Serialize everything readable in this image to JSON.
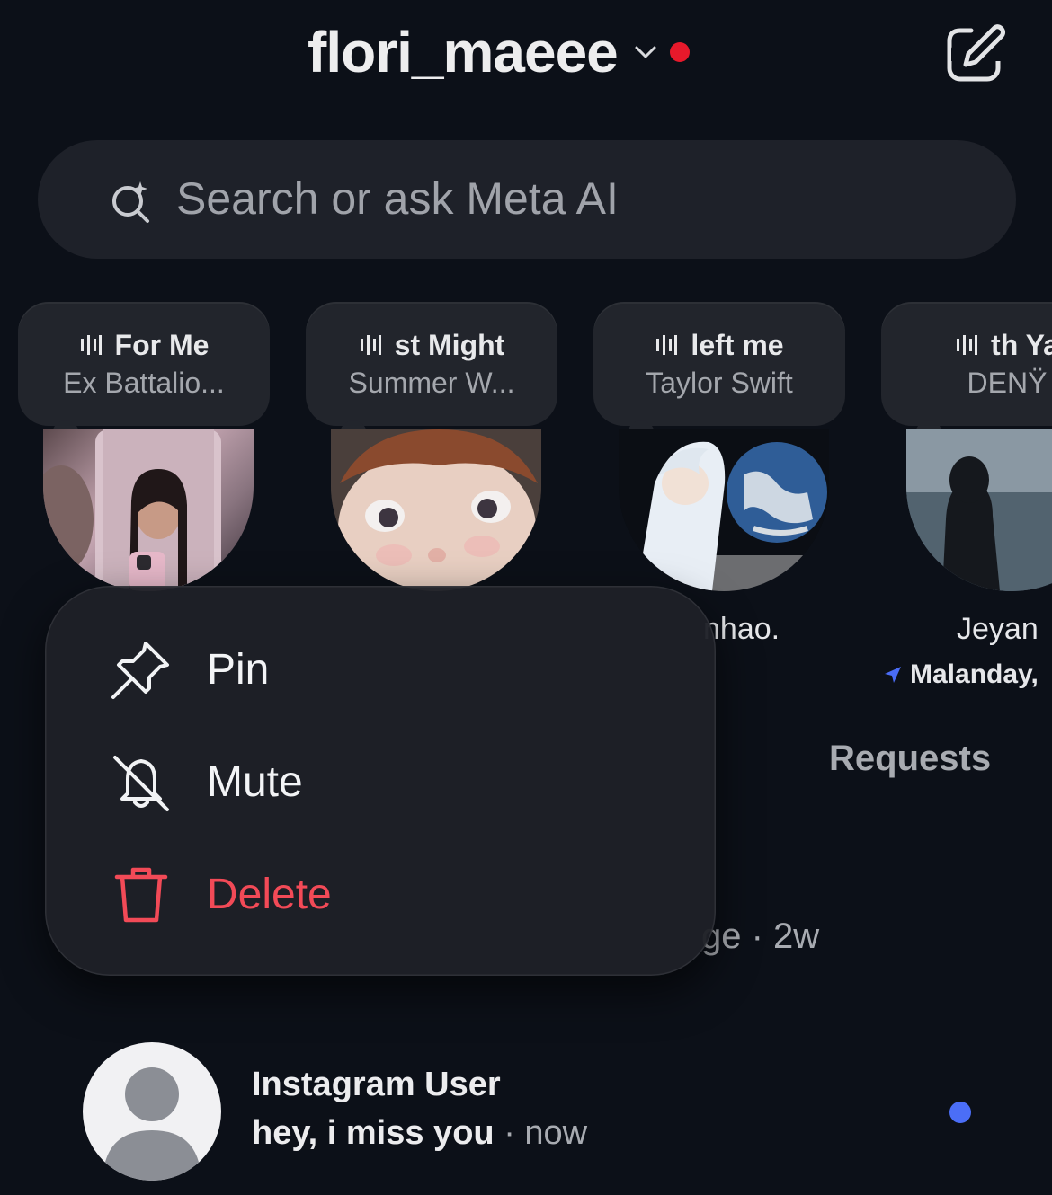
{
  "header": {
    "username": "flori_maeee",
    "icons": {
      "chevron": "chevron-down-icon",
      "status": "red-dot",
      "compose": "compose-icon"
    },
    "status_dot_color": "#e7192b"
  },
  "search": {
    "placeholder": "Search or ask Meta AI",
    "icon": "meta-ai-search-icon"
  },
  "notes": [
    {
      "song": "For Me",
      "artist": "Ex Battalio...",
      "avatar": "photo-selfie-phone"
    },
    {
      "song": "st Might",
      "artist": "Summer W...",
      "avatar": "photo-doll-face"
    },
    {
      "song": "left me",
      "artist": "Taylor Swift",
      "avatar": "photo-anime-earth",
      "name": "nhao."
    },
    {
      "song": "th Ya",
      "artist": "DENŸ",
      "avatar": "photo-sea-silhouette",
      "name": "Jeyan",
      "location": "Malanday,"
    }
  ],
  "requests_label": "Requests",
  "background_preview": "ge · 2w",
  "context_menu": {
    "items": [
      {
        "label": "Pin",
        "icon": "pin-icon",
        "destructive": false
      },
      {
        "label": "Mute",
        "icon": "bell-off-icon",
        "destructive": false
      },
      {
        "label": "Delete",
        "icon": "trash-icon",
        "destructive": true
      }
    ],
    "destructive_color": "#f24a57"
  },
  "chat": {
    "name": "Instagram User",
    "message": "hey, i miss you",
    "separator": "·",
    "time": "now",
    "unread": true,
    "unread_color": "#4b6ef7",
    "avatar": "default-avatar-icon"
  }
}
